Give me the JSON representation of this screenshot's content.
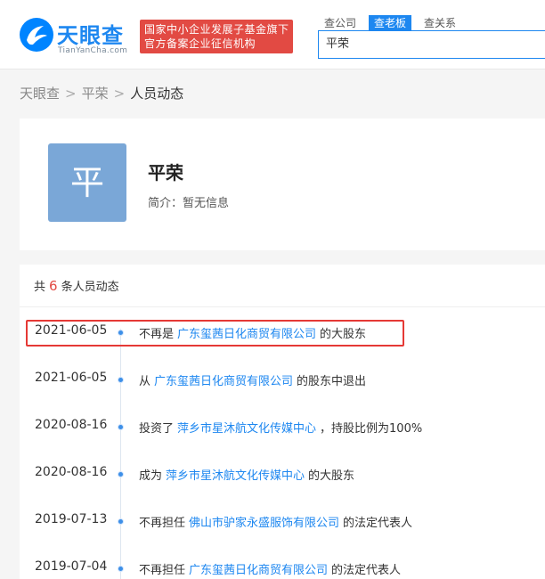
{
  "header": {
    "logo_text": "天眼查",
    "logo_sub": "TianYanCha.com",
    "badge_line1": "国家中小企业发展子基金旗下",
    "badge_line2": "官方备案企业征信机构",
    "tabs": [
      "查公司",
      "查老板",
      "查关系"
    ],
    "active_tab": "查老板",
    "search_value": "平荣"
  },
  "breadcrumb": {
    "home": "天眼查",
    "person": "平荣",
    "current": "人员动态",
    "sep": ">"
  },
  "profile": {
    "avatar_char": "平",
    "name": "平荣",
    "intro": "简介：暂无信息"
  },
  "dynamics": {
    "prefix": "共",
    "count": "6",
    "suffix": "条人员动态",
    "items": [
      {
        "date": "2021-06-05",
        "before": "不再是",
        "company": "广东玺茜日化商贸有限公司",
        "after": "的大股东"
      },
      {
        "date": "2021-06-05",
        "before": "从",
        "company": "广东玺茜日化商贸有限公司",
        "after": "的股东中退出"
      },
      {
        "date": "2020-08-16",
        "before": "投资了",
        "company": "萍乡市星沐航文化传媒中心",
        "after": "，持股比例为100%"
      },
      {
        "date": "2020-08-16",
        "before": "成为",
        "company": "萍乡市星沐航文化传媒中心",
        "after": "的大股东"
      },
      {
        "date": "2019-07-13",
        "before": "不再担任",
        "company": "佛山市驴家永盛服饰有限公司",
        "after": "的法定代表人"
      },
      {
        "date": "2019-07-04",
        "before": "不再担任",
        "company": "广东玺茜日化商贸有限公司",
        "after": "的法定代表人"
      }
    ]
  },
  "colors": {
    "brand_blue": "#1d87f0",
    "badge_red": "#e24a43",
    "highlight_red": "#e53935",
    "avatar_bg": "#7aa7d7"
  }
}
